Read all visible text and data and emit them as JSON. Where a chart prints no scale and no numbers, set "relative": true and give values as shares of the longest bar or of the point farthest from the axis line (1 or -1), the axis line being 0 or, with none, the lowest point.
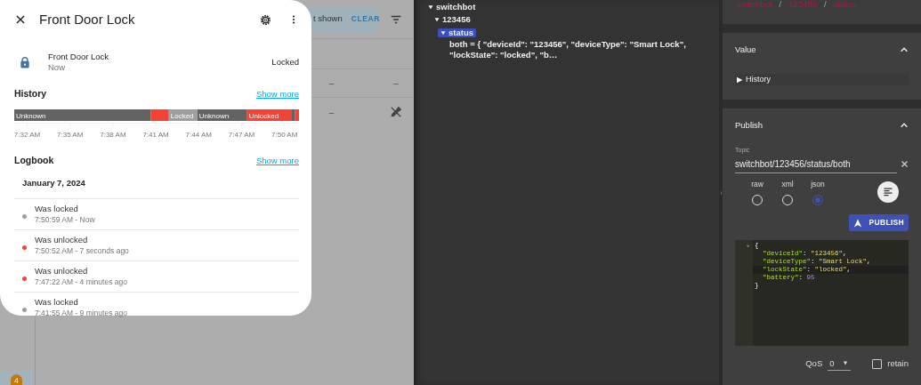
{
  "background_page": {
    "filter_chip": {
      "text": "t shown",
      "action": "CLEAR"
    },
    "rows": [
      {
        "column_1": "–",
        "column_2": "–"
      },
      {
        "column_1": "–"
      }
    ],
    "notification_count": "4"
  },
  "dialog": {
    "title": "Front Door Lock",
    "entity": {
      "name": "Front Door Lock",
      "time": "Now",
      "state": "Locked"
    },
    "history": {
      "title": "History",
      "link": "Show more",
      "chart_data": {
        "type": "bar",
        "orientation": "horizontal",
        "stacked": true,
        "relative": true,
        "categories": [
          null
        ],
        "series": [
          {
            "name": "Unknown",
            "color": "#636363",
            "values": [
              0.48
            ]
          },
          {
            "color": "#f44336",
            "values": [
              0.063
            ]
          },
          {
            "name": "Locked",
            "color": "#9e9e9e",
            "values": [
              0.1
            ]
          },
          {
            "name": "Unknown",
            "color": "#636363",
            "values": [
              0.175
            ]
          },
          {
            "name": "Unlocked",
            "color": "#f44336",
            "values": [
              0.157
            ]
          },
          {
            "color": "#636363",
            "values": [
              0.01
            ]
          },
          {
            "color": "#f44336",
            "values": [
              0.015
            ]
          }
        ]
      },
      "time_labels": [
        "7:32 AM",
        "7:35 AM",
        "7:38 AM",
        "7:41 AM",
        "7:44 AM",
        "7:47 AM",
        "7:50 AM"
      ]
    },
    "logbook": {
      "title": "Logbook",
      "link": "Show more",
      "date": "January 7, 2024",
      "entries": [
        {
          "title": "Was locked",
          "time": "7:50:59 AM - Now",
          "kind": "locked"
        },
        {
          "title": "Was unlocked",
          "time": "7:50:52 AM - 7 seconds ago",
          "kind": "unlocked"
        },
        {
          "title": "Was unlocked",
          "time": "7:47:22 AM - 4 minutes ago",
          "kind": "unlocked"
        },
        {
          "title": "Was locked",
          "time": "7:41:55 AM - 9 minutes ago",
          "kind": "locked"
        }
      ]
    }
  },
  "tree": {
    "label": "switchbot",
    "expanded": true,
    "selected": false,
    "children": [
      {
        "label": "123456",
        "expanded": true,
        "selected": false,
        "children": [
          {
            "label": "status",
            "expanded": true,
            "selected": true,
            "children": [
              {
                "label": "both = { \"deviceId\": \"123456\", \"deviceType\": \"Smart Lock\", \"lockState\": \"locked\", \"b…",
                "selected": false
              }
            ]
          }
        ]
      }
    ]
  },
  "breadcrumb": {
    "parts": [
      "switchbot",
      "123456",
      "status"
    ],
    "separator": "/"
  },
  "value_panel": {
    "title": "Value",
    "expanded": true,
    "history": {
      "label": "History",
      "expanded": false
    }
  },
  "publish_panel": {
    "title": "Publish",
    "expanded": true,
    "topic": {
      "label": "Topic",
      "value": "switchbot/123456/status/both"
    },
    "formats": [
      {
        "label": "raw",
        "selected": false
      },
      {
        "label": "xml",
        "selected": false
      },
      {
        "label": "json",
        "selected": true
      }
    ],
    "button": "PUBLISH",
    "editor": {
      "lines": [
        {
          "text": "{",
          "current": false
        },
        {
          "text": "  \"deviceId\": \"123456\",",
          "current": false
        },
        {
          "text": "  \"deviceType\": \"Smart Lock\",",
          "current": false
        },
        {
          "text": "  \"lockState\": \"locked\",",
          "current": true
        },
        {
          "text": "  \"battery\": 95",
          "current": false
        },
        {
          "text": "}",
          "current": false
        }
      ]
    },
    "qos": {
      "label": "QoS",
      "value": "0"
    },
    "retain": {
      "label": "retain",
      "checked": false
    }
  }
}
